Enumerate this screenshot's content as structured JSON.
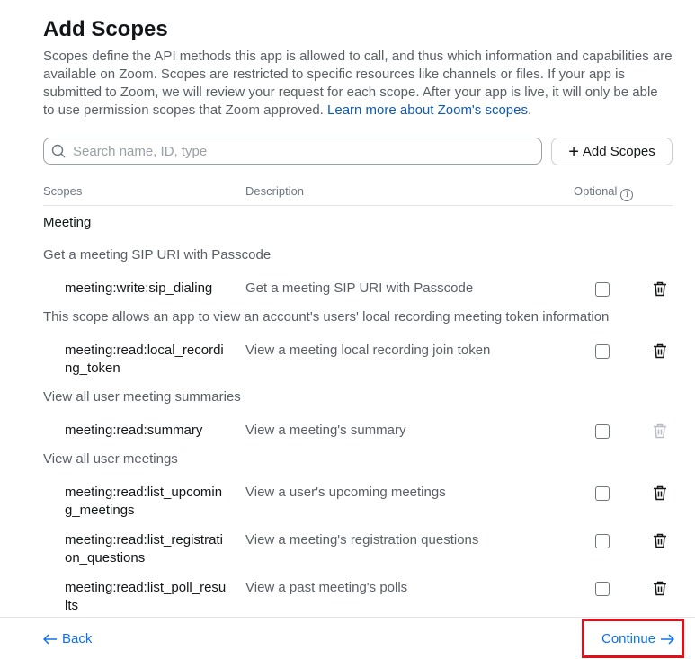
{
  "header": {
    "title": "Add Scopes",
    "intro": "Scopes define the API methods this app is allowed to call, and thus which information and capabilities are available on Zoom. Scopes are restricted to specific resources like channels or files. If your app is submitted to Zoom, we will review your request for each scope. After your app is live, it will only be able to use permission scopes that Zoom approved.",
    "learn_more": "Learn more about Zoom's scopes",
    "learn_more_suffix": "."
  },
  "search": {
    "placeholder": "Search name, ID, type",
    "value": ""
  },
  "add_button": {
    "label": "Add Scopes"
  },
  "table": {
    "columns": {
      "scopes": "Scopes",
      "description": "Description",
      "optional": "Optional"
    },
    "group": "Meeting",
    "sections": [
      {
        "desc": "Get a meeting SIP URI with Passcode",
        "name": "meeting:write:sip_dialing",
        "scope_desc": "Get a meeting SIP URI with Passcode",
        "optional": false
      },
      {
        "desc": "This scope allows an app to view an account's users' local recording meeting token information",
        "name": "meeting:read:local_recording_token",
        "scope_desc": "View a meeting local recording join token",
        "optional": false
      },
      {
        "desc": "View all user meeting summaries",
        "name": "meeting:read:summary",
        "scope_desc": "View a meeting's summary",
        "optional": false
      },
      {
        "desc": "View all user meetings",
        "name": "meeting:read:list_upcoming_meetings",
        "scope_desc": "View a user's upcoming meetings",
        "optional": false
      },
      {
        "name": "meeting:read:list_registration_questions",
        "scope_desc": "View a meeting's registration questions",
        "optional": false
      },
      {
        "name": "meeting:read:list_poll_results",
        "scope_desc": "View a past meeting's polls",
        "optional": false
      }
    ]
  },
  "footer": {
    "back_label": "Back",
    "continue_label": "Continue"
  },
  "colors": {
    "link": "#0e72ed",
    "highlight": "#e0101a"
  }
}
